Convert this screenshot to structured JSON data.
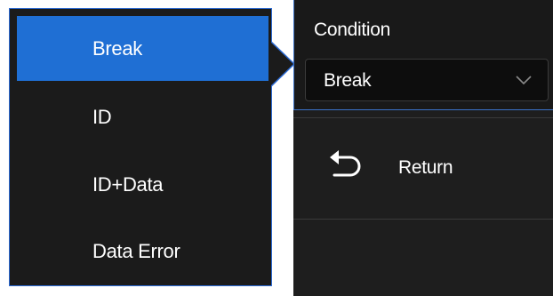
{
  "popup": {
    "items": [
      {
        "label": "Break",
        "selected": true
      },
      {
        "label": "ID",
        "selected": false
      },
      {
        "label": "ID+Data",
        "selected": false
      },
      {
        "label": "Data Error",
        "selected": false
      }
    ]
  },
  "panel": {
    "condition_label": "Condition",
    "condition_value": "Break",
    "return_label": "Return"
  },
  "colors": {
    "accent": "#1f6fd4",
    "border_accent": "#2d6cd6",
    "background": "#1b1b1b"
  },
  "icons": {
    "dropdown": "chevron-down-icon",
    "return": "return-arrow-icon"
  }
}
